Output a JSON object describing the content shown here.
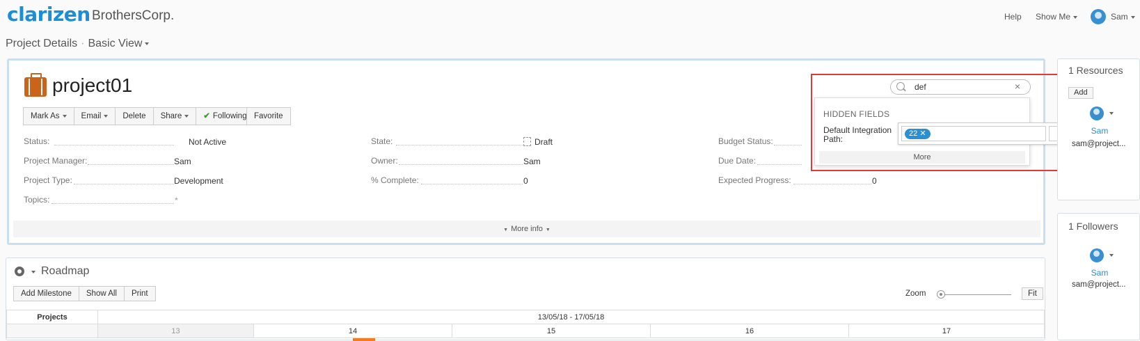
{
  "header": {
    "logo": "clarizen",
    "company": "BrothersCorp.",
    "help": "Help",
    "show_me": "Show Me",
    "user": "Sam"
  },
  "breadcrumb": {
    "page": "Project Details",
    "view": "Basic View"
  },
  "project": {
    "title": "project01",
    "actions": [
      "Mark As",
      "Email",
      "Delete",
      "Share",
      "Following"
    ],
    "favorite": "Favorite",
    "fields_col1": [
      {
        "label": "Status:",
        "value": "Not Active"
      },
      {
        "label": "Project Manager:",
        "value": "Sam"
      },
      {
        "label": "Project Type:",
        "value": "Development"
      },
      {
        "label": "Topics:",
        "value": "*"
      }
    ],
    "fields_col2": [
      {
        "label": "State:",
        "value": "Draft"
      },
      {
        "label": "Owner:",
        "value": "Sam"
      },
      {
        "label": "% Complete:",
        "value": "0"
      }
    ],
    "fields_col3": [
      {
        "label": "Budget Status:",
        "value": ""
      },
      {
        "label": "Due Date:",
        "value": ""
      },
      {
        "label": "Expected Progress:",
        "value": "0"
      }
    ],
    "more_info": "More info"
  },
  "field_search": {
    "query": "def",
    "clear": "×",
    "section": "HIDDEN FIELDS",
    "field_label": "Default Integration Path:",
    "tag_value": "22",
    "tag_remove": "✕",
    "more_button": "⋯",
    "more": "More"
  },
  "resources": {
    "title": "1 Resources",
    "add": "Add",
    "name": "Sam",
    "email": "sam@project..."
  },
  "followers": {
    "title": "1 Followers",
    "name": "Sam",
    "email": "sam@project..."
  },
  "roadmap": {
    "title": "Roadmap",
    "buttons": [
      "Add Milestone",
      "Show All",
      "Print"
    ],
    "zoom": "Zoom",
    "fit": "Fit",
    "col_projects": "Projects",
    "date_range": "13/05/18 - 17/05/18",
    "days": [
      "13",
      "14",
      "15",
      "16",
      "17"
    ]
  },
  "colors": {
    "brand": "#1a8fd6",
    "highlight": "#e53935",
    "tag": "#2b8fd4",
    "project_icon": "#c9641a"
  }
}
